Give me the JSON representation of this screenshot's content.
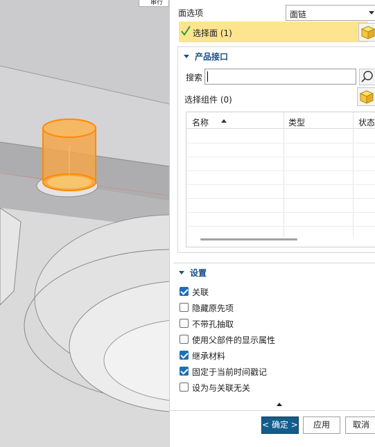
{
  "viewport": {
    "top_chip": "串行"
  },
  "face_option": {
    "label": "面选项",
    "value": "面链"
  },
  "selection": {
    "label": "选择面 (1)"
  },
  "product_interface": {
    "header": "产品接口",
    "search_label": "搜索",
    "search_value": "",
    "select_component": "选择组件 (0)",
    "columns": [
      "名称",
      "类型",
      "状态"
    ]
  },
  "settings": {
    "header": "设置",
    "options": [
      {
        "label": "关联",
        "checked": true
      },
      {
        "label": "隐藏原先项",
        "checked": false
      },
      {
        "label": "不带孔抽取",
        "checked": false
      },
      {
        "label": "使用父部件的显示属性",
        "checked": false
      },
      {
        "label": "继承材料",
        "checked": true
      },
      {
        "label": "固定于当前时间戳记",
        "checked": true
      },
      {
        "label": "设为与关联无关",
        "checked": false
      }
    ]
  },
  "buttons": {
    "ok": "< 确定 >",
    "apply": "应用",
    "cancel": "取消"
  },
  "colors": {
    "accent": "#135d8c",
    "highlight": "#fde48f",
    "check": "#1c6fb8",
    "header": "#1b4f86"
  }
}
